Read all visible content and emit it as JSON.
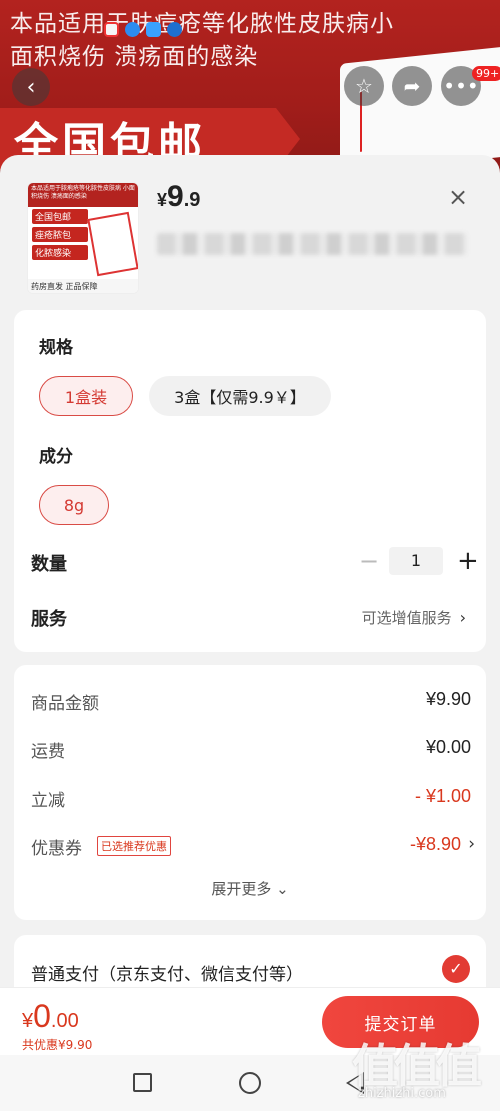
{
  "background": {
    "title": "本品适用于肤痘疮等化脓性皮肤病小面积烧伤 溃疡面的感染",
    "banner": "全国包邮",
    "badge": "99+"
  },
  "product": {
    "thumb_top": "本品适用于脓疱疮等化脓性皮肤病 小面积烧伤 溃疡面的感染",
    "thumb_lines": [
      "全国包邮",
      "痤疮脓包",
      "化脓感染"
    ],
    "thumb_footer": "药房直发 正品保障",
    "price_currency": "¥",
    "price_int": "9",
    "price_dec": ".9"
  },
  "spec": {
    "label": "规格",
    "options": [
      "1盒装",
      "3盒【仅需9.9￥】"
    ],
    "selected": 0
  },
  "ingredient": {
    "label": "成分",
    "options": [
      "8g"
    ],
    "selected": 0
  },
  "quantity": {
    "label": "数量",
    "value": "1",
    "minus": "−",
    "plus": "+"
  },
  "service": {
    "label": "服务",
    "value": "可选增值服务"
  },
  "fees": {
    "rows": [
      {
        "label": "商品金额",
        "value": "¥9.90"
      },
      {
        "label": "运费",
        "value": "¥0.00"
      },
      {
        "label": "立减",
        "value": "- ¥1.00"
      },
      {
        "label": "优惠券",
        "value": "-¥8.90",
        "tag": "已选推荐优惠"
      }
    ],
    "expand": "展开更多 ⌄"
  },
  "payment": {
    "label": "普通支付（京东支付、微信支付等）",
    "checked": true
  },
  "bottom": {
    "total_currency": "¥",
    "total_int": "0",
    "total_dec": ".00",
    "saved": "共优惠¥9.90",
    "submit": "提交订单"
  },
  "watermark": {
    "logo": "值值值",
    "text": "zhizhizhi.com"
  },
  "colors": {
    "accent": "#e23b33",
    "price_red": "#d9381e",
    "header_bg": "#b3231f"
  }
}
